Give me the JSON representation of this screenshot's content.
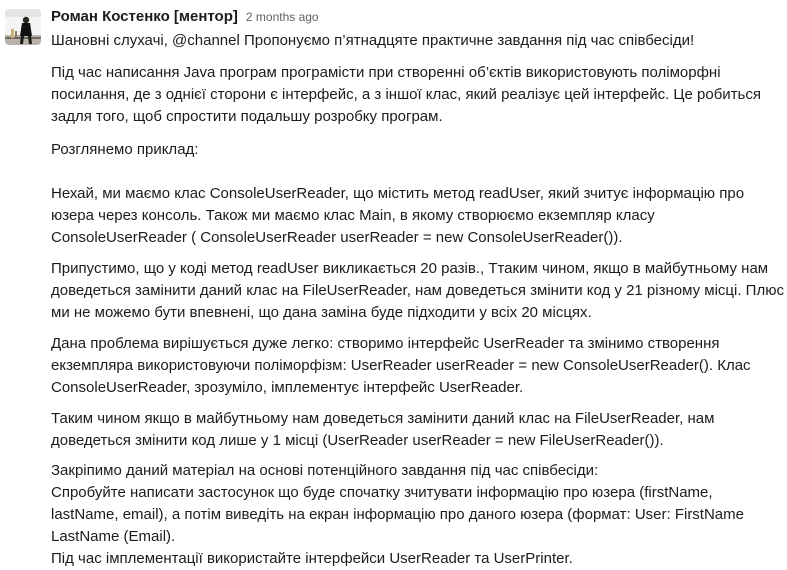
{
  "message": {
    "sender": "Роман Костенко [ментор]",
    "timestamp": "2 months ago",
    "paragraphs": [
      "Шановні слухачі, @channel Пропонуємо п’ятнадцяте практичне завдання під час співбесіди!",
      "Під час написання Java програм програмісти при створенні об’єктів використовують поліморфні посилання, де з однієї сторони є інтерфейс, а з іншої клас, який реалізує цей інтерфейс. Це робиться задля того, щоб спростити подальшу розробку програм.",
      "Розглянемо приклад:",
      "Нехай, ми маємо клас ConsoleUserReader, що містить метод readUser, який зчитує інформацію про юзера через консоль. Також ми маємо клас Main, в якому створюємо екземпляр класу ConsoleUserReader ( ConsoleUserReader userReader = new ConsoleUserReader()).",
      "Припустимо, що у коді метод readUser викликається 20 разів., Ттаким чином, якщо в майбутньому нам доведеться замінити даний клас на FileUserReader, нам доведеться змінити код у 21 різному місці. Плюс ми не можемо бути впевнені, що дана заміна буде підходити у всіх 20 місцях.",
      "Дана проблема вирішується дуже легко: створимо інтерфейс UserReader та змінимо створення екземпляра використовуючи поліморфізм: UserReader userReader = new ConsoleUserReader(). Клас ConsoleUserReader, зрозуміло, імплементує інтерфейс UserReader.",
      "Таким чином якщо в майбутньому нам доведеться замінити даний клас на FileUserReader, нам доведеться змінити код лише у 1 місці (UserReader userReader = new FileUserReader()).",
      "Закріпимо даний матеріал на основі потенційного завдання під час співбесіди:\nСпробуйте написати застосунок що буде спочатку зчитувати інформацію про юзера (firstName, lastName, email), а потім виведіть на екран інформацію про даного юзера (формат: User: FirstName LastName (Email).\nПід час імплементації використайте інтерфейси UserReader та UserPrinter."
    ]
  }
}
